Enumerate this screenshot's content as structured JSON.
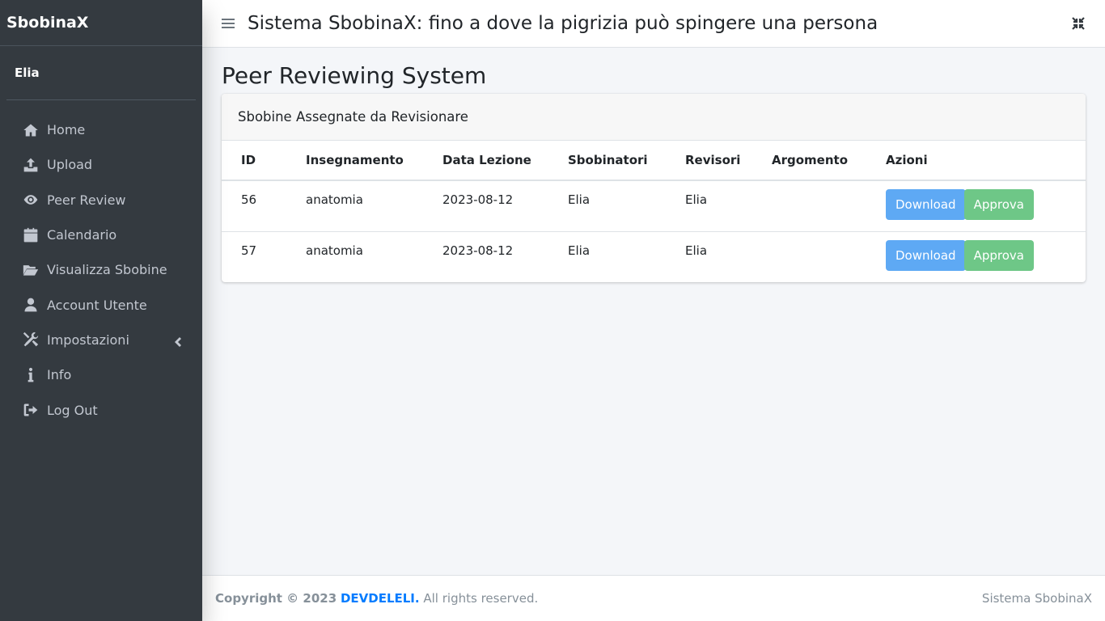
{
  "sidebar": {
    "brand": "SbobinaX",
    "user": "Elia",
    "items": [
      {
        "label": "Home",
        "icon": "home-icon"
      },
      {
        "label": "Upload",
        "icon": "upload-icon"
      },
      {
        "label": "Peer Review",
        "icon": "eye-icon"
      },
      {
        "label": "Calendario",
        "icon": "calendar-icon"
      },
      {
        "label": "Visualizza Sbobine",
        "icon": "folder-open-icon"
      },
      {
        "label": "Account Utente",
        "icon": "user-icon"
      },
      {
        "label": "Impostazioni",
        "icon": "tools-icon"
      },
      {
        "label": "Info",
        "icon": "info-icon"
      },
      {
        "label": "Log Out",
        "icon": "sign-out-icon"
      }
    ]
  },
  "navbar": {
    "title": "Sistema SbobinaX: fino a dove la pigrizia può spingere una persona"
  },
  "main": {
    "page_title": "Peer Reviewing System",
    "card_title": "Sbobine Assegnate da Revisionare",
    "columns": [
      "ID",
      "Insegnamento",
      "Data Lezione",
      "Sbobinatori",
      "Revisori",
      "Argomento",
      "Azioni"
    ],
    "rows": [
      {
        "id": "56",
        "insegnamento": "anatomia",
        "data": "2023-08-12",
        "sbobinatori": "Elia",
        "revisori": "Elia",
        "argomento": "",
        "download": "Download",
        "approva": "Approva"
      },
      {
        "id": "57",
        "insegnamento": "anatomia",
        "data": "2023-08-12",
        "sbobinatori": "Elia",
        "revisori": "Elia",
        "argomento": "",
        "download": "Download",
        "approva": "Approva"
      }
    ]
  },
  "footer": {
    "copyright_prefix": "Copyright © 2023",
    "copyright_brand": "DEVDELELI.",
    "copyright_suffix": "All rights reserved.",
    "right_text": "Sistema SbobinaX"
  },
  "colors": {
    "sidebar_bg": "#343a40",
    "download_btn": "#5ea9f4",
    "approva_btn": "#6ec787",
    "link": "#007bff"
  }
}
